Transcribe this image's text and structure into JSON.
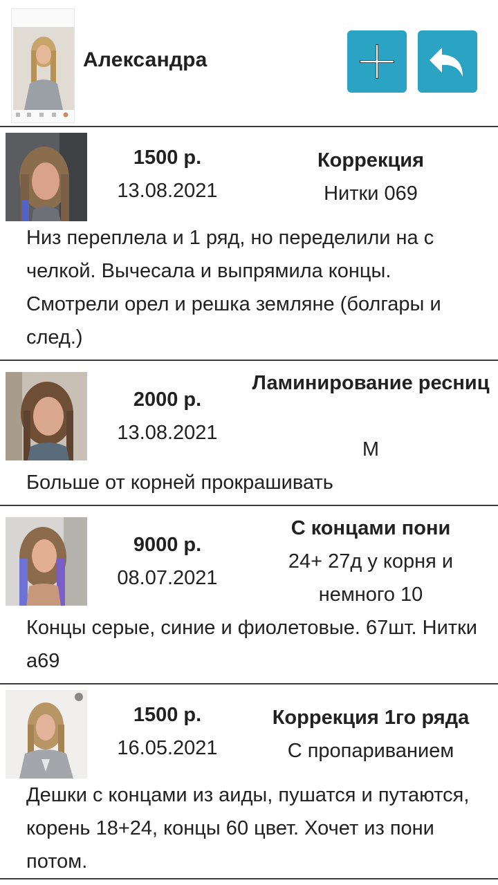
{
  "client": {
    "name": "Александра"
  },
  "header": {
    "add_icon": "plus-icon",
    "back_icon": "reply-arrow-icon",
    "button_color": "#2aa4c2"
  },
  "records": [
    {
      "price": "1500 р.",
      "date": "13.08.2021",
      "service": "Коррекция",
      "detail": "Нитки 069",
      "note": "Низ переплела и 1 ряд, но переделили на с челкой. Вычесала и выпрямила концы. Смотрели орел и решка земляне (болгары и след.)"
    },
    {
      "price": "2000 р.",
      "date": "13.08.2021",
      "service": "Ламинирование ресниц",
      "detail": "М",
      "note": "Больше от корней прокрашивать"
    },
    {
      "price": "9000 р.",
      "date": "08.07.2021",
      "service": "С концами пони",
      "detail": "24+ 27д у корня и немного 10",
      "note": "Концы серые, синие и фиолетовые. 67шт. Нитки а69"
    },
    {
      "price": "1500 р.",
      "date": "16.05.2021",
      "service": "Коррекция 1го ряда",
      "detail": "С пропариванием",
      "note": "Дешки с концами из аиды, пушатся и путаются, корень 18+24, концы 60 цвет. Хочет из пони потом."
    }
  ]
}
